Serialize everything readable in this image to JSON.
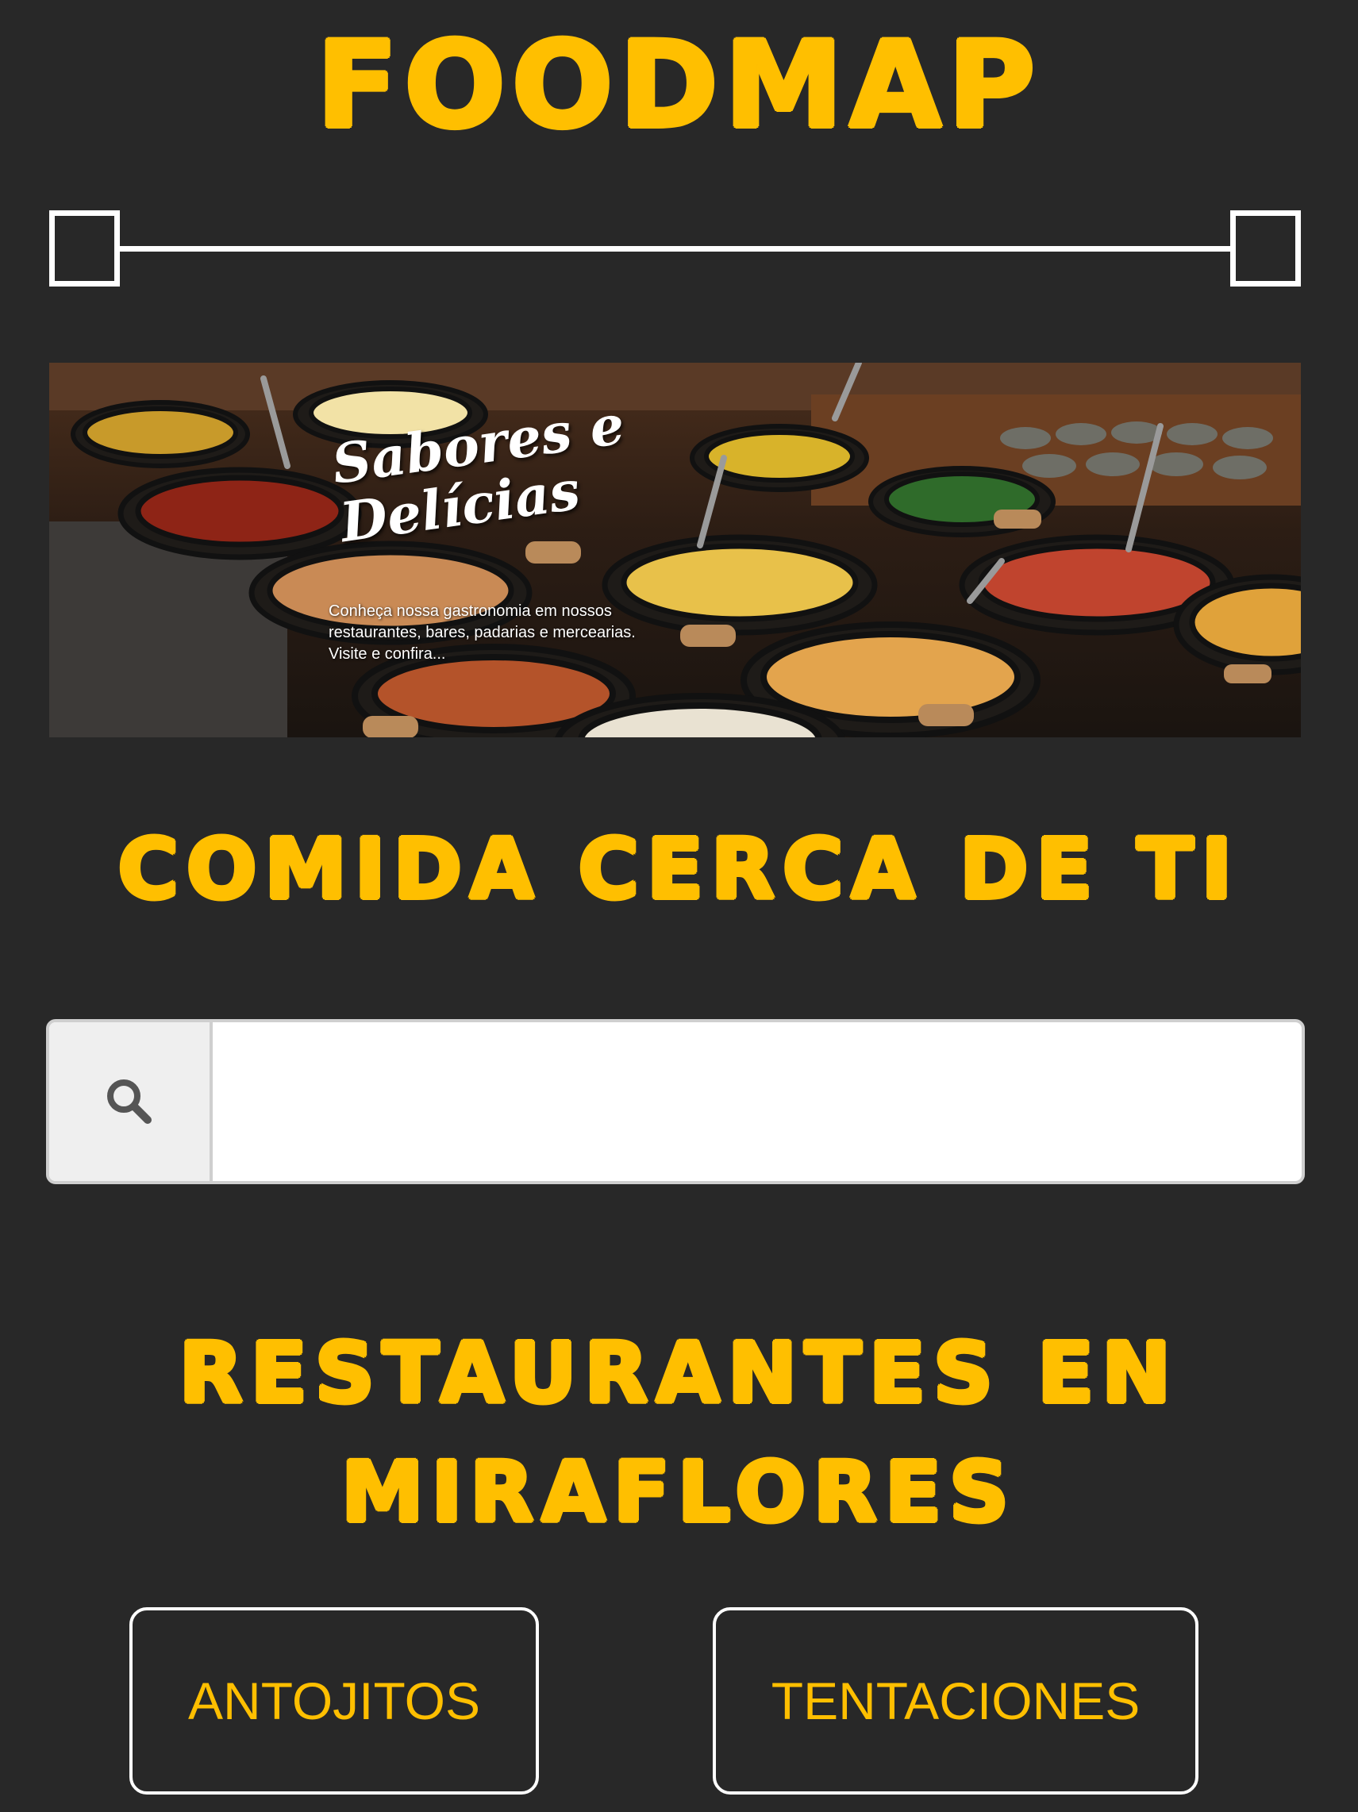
{
  "header": {
    "logo_text": "FOODMAP"
  },
  "slider": {
    "range_min_fraction": 0.0,
    "range_max_fraction": 1.0
  },
  "banner": {
    "script_title": "Sabores e Delícias",
    "caption": "Conheça nossa gastronomia em nossos restaurantes, bares, padarias e mercearias. Visite e confira..."
  },
  "subtitle": "COMIDA CERCA DE TI",
  "search": {
    "icon": "search-icon",
    "value": "",
    "placeholder": ""
  },
  "section": {
    "title": "RESTAURANTES EN MIRAFLORES"
  },
  "categories": [
    {
      "label": "ANTOJITOS"
    },
    {
      "label": "TENTACIONES"
    }
  ],
  "colors": {
    "background": "#282828",
    "accent": "#ffbf00",
    "outline": "#ffffff"
  }
}
